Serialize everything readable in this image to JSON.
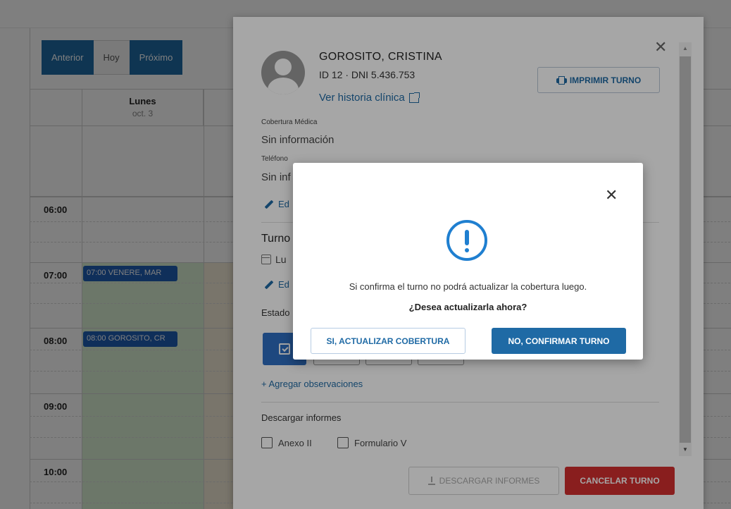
{
  "calendar": {
    "nav": {
      "prev": "Anterior",
      "today": "Hoy",
      "next": "Próximo"
    },
    "day": {
      "name": "Lunes",
      "date": "oct. 3"
    },
    "times": [
      "06:00",
      "07:00",
      "08:00",
      "09:00",
      "10:00"
    ],
    "events": [
      "07:00 VENERE, MAR",
      "08:00 GOROSITO, CR"
    ],
    "colors": {
      "nav": "#1f6aa5",
      "event": "#1f5fb5",
      "available": "#d9efd2"
    }
  },
  "dialog": {
    "patient_name": "GOROSITO, CRISTINA",
    "patient_id": "ID 12 · DNI 5.436.753",
    "history_link": "Ver historia clínica",
    "print_button": "IMPRIMIR TURNO",
    "coverage_label": "Cobertura Médica",
    "coverage_value": "Sin información",
    "phone_label": "Teléfono",
    "phone_value": "Sin inf",
    "edit_label_1": "Ed",
    "section_turno": "Turno",
    "turno_date": "Lu",
    "edit_label_2": "Ed",
    "estado_label": "Estado",
    "add_observations": "+ Agregar observaciones",
    "download_title": "Descargar informes",
    "checkboxes": [
      "Anexo II",
      "Formulario V"
    ],
    "download_button": "DESCARGAR INFORMES",
    "cancel_button": "CANCELAR TURNO",
    "colors": {
      "link": "#1f6aa5",
      "cancel": "#d32f2f",
      "status_active": "#2e6fc4"
    }
  },
  "confirm": {
    "message": "Si confirma el turno no podrá actualizar la cobertura luego.",
    "question": "¿Desea actualizarla ahora?",
    "update_button": "SI, ACTUALIZAR COBERTURA",
    "confirm_button": "NO, CONFIRMAR TURNO",
    "icon": "alert-circle-icon",
    "colors": {
      "icon": "#1f7fd0",
      "primary": "#1f6aa5"
    }
  }
}
